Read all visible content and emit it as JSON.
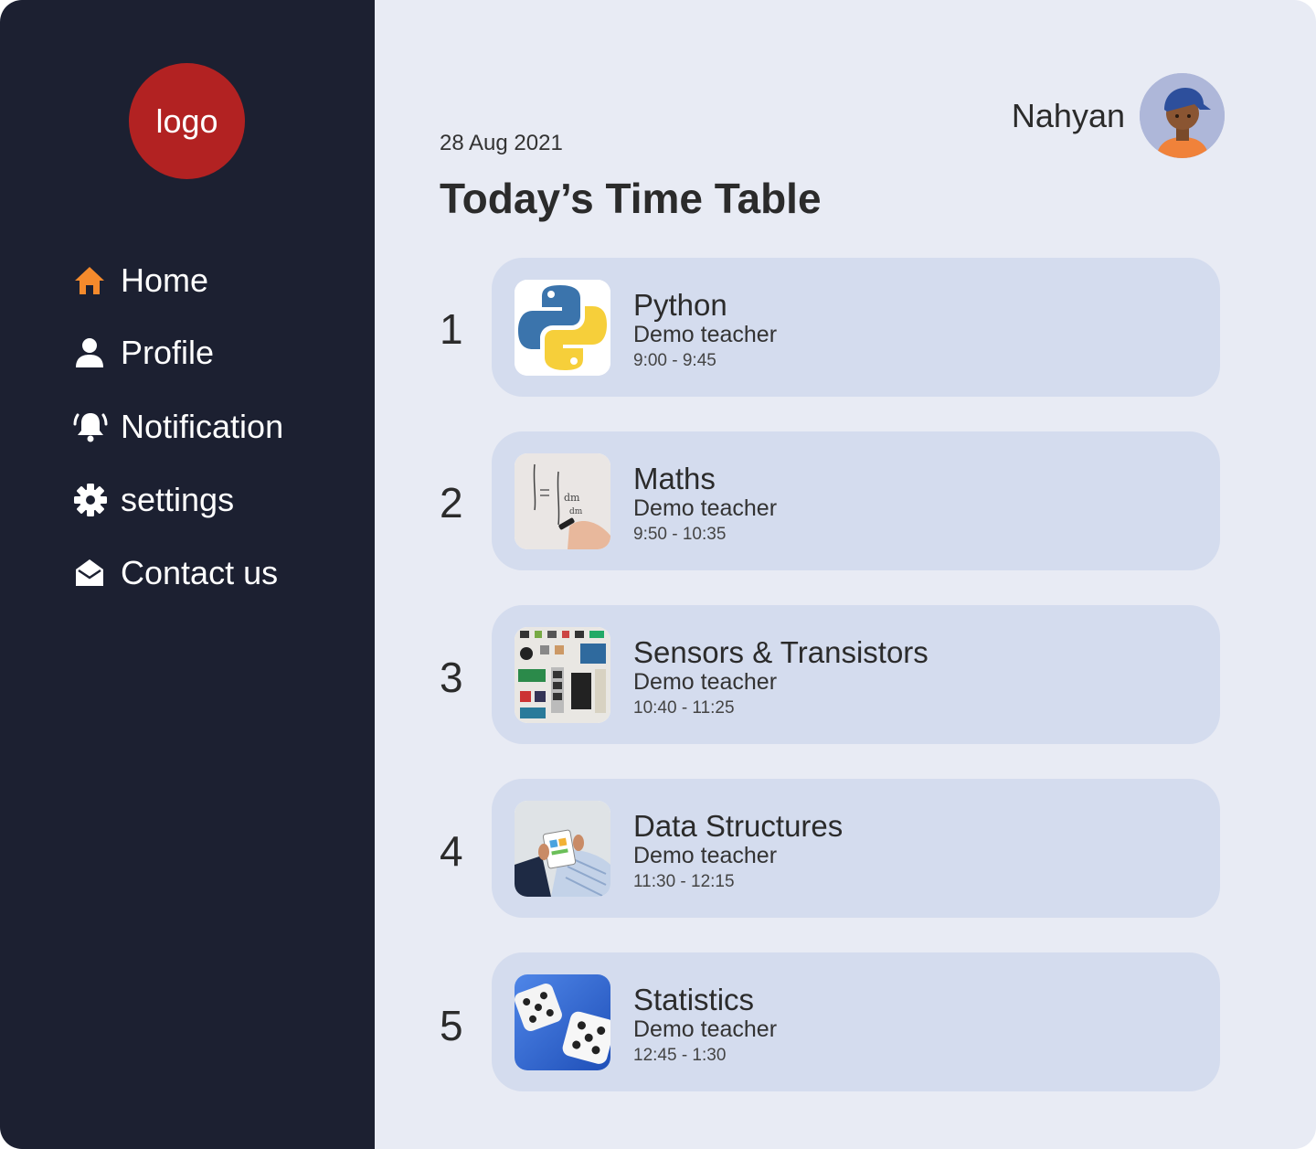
{
  "sidebar": {
    "logo_text": "logo",
    "items": [
      {
        "label": "Home",
        "icon": "home-icon",
        "active": true
      },
      {
        "label": "Profile",
        "icon": "user-icon"
      },
      {
        "label": "Notification",
        "icon": "bell-icon"
      },
      {
        "label": "settings",
        "icon": "gear-icon"
      },
      {
        "label": "Contact us",
        "icon": "envelope-open-icon"
      }
    ]
  },
  "header": {
    "date": "28 Aug 2021",
    "title": "Today’s Time Table",
    "user_name": "Nahyan"
  },
  "timetable": [
    {
      "index": "1",
      "subject": "Python",
      "teacher": "Demo teacher",
      "time": "9:00 - 9:45"
    },
    {
      "index": "2",
      "subject": "Maths",
      "teacher": "Demo teacher",
      "time": "9:50 - 10:35"
    },
    {
      "index": "3",
      "subject": "Sensors & Transistors",
      "teacher": "Demo teacher",
      "time": "10:40 - 11:25"
    },
    {
      "index": "4",
      "subject": "Data Structures",
      "teacher": "Demo teacher",
      "time": "11:30 - 12:15"
    },
    {
      "index": "5",
      "subject": "Statistics",
      "teacher": "Demo teacher",
      "time": "12:45 - 1:30"
    }
  ],
  "colors": {
    "sidebar_bg": "#1c2031",
    "main_bg": "#e8ebf4",
    "card_bg": "#d4dcee",
    "logo_bg": "#b22222",
    "accent_orange": "#f58a2c"
  }
}
